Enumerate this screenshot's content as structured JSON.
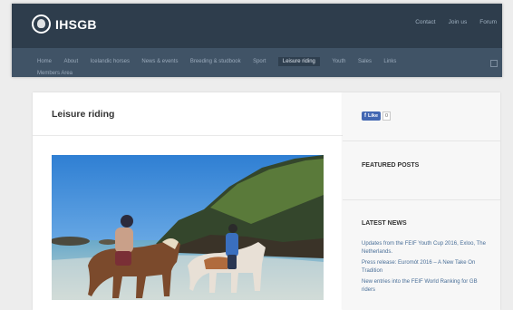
{
  "header": {
    "logo_text": "IHSGB",
    "top_links": [
      "Contact",
      "Join us",
      "Forum"
    ],
    "nav_items": [
      "Home",
      "About",
      "Icelandic horses",
      "News & events",
      "Breeding & studbook",
      "Sport",
      "Leisure riding",
      "Youth",
      "Sales",
      "Links",
      "Members Area"
    ],
    "active_nav": "Leisure riding"
  },
  "main": {
    "title": "Leisure riding",
    "photo_icon": "beach-riding-photo"
  },
  "sidebar": {
    "like_label": "Like",
    "like_count": "0",
    "featured_heading": "FEATURED POSTS",
    "latest_heading": "LATEST NEWS",
    "news": [
      "Updates from the FEIF Youth Cup 2016, Exloo, The Netherlands.",
      "Press release: Euromót 2016 – A New Take On Tradition",
      "New entries into the FEIF World Ranking for GB riders"
    ]
  },
  "colors": {
    "header_bg": "#2e3d4c",
    "nav_bg": "#405366",
    "link": "#4a6f98",
    "facebook": "#4267b2"
  }
}
